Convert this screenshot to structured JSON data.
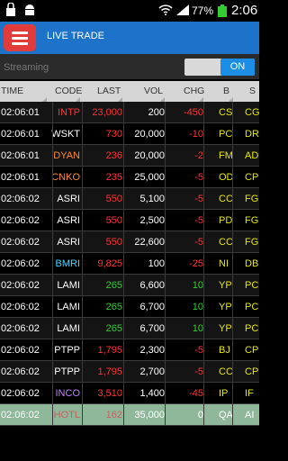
{
  "status_bar": {
    "percent": "77%",
    "time": "2:06"
  },
  "app_bar": {
    "title": "LIVE TRADE"
  },
  "streaming": {
    "label": "Streaming",
    "toggle": "ON"
  },
  "columns": [
    "TIME",
    "CODE",
    "LAST",
    "VOL",
    "CHG",
    "B",
    "S"
  ],
  "rows": [
    {
      "time": "02:06:01",
      "code": "INTP",
      "last": "23,000",
      "vol": "200",
      "chg": "-450",
      "b": "CS",
      "s": "CG",
      "code_color": "#ff3333",
      "last_color": "#ff3333",
      "chg_color": "#ff3333"
    },
    {
      "time": "02:06:01",
      "code": "WSKT",
      "last": "730",
      "vol": "20,000",
      "chg": "-10",
      "b": "PC",
      "s": "DR",
      "code_color": "#ffffff",
      "last_color": "#ff3333",
      "chg_color": "#ff3333"
    },
    {
      "time": "02:06:01",
      "code": "DYAN",
      "last": "236",
      "vol": "20,000",
      "chg": "-2",
      "b": "FM",
      "s": "AD",
      "code_color": "#ff8c2a",
      "last_color": "#ff3333",
      "chg_color": "#ff3333"
    },
    {
      "time": "02:06:01",
      "code": "CNKO",
      "last": "235",
      "vol": "25,000",
      "chg": "-5",
      "b": "OD",
      "s": "CP",
      "code_color": "#ff8c2a",
      "last_color": "#ff3333",
      "chg_color": "#ff3333"
    },
    {
      "time": "02:06:02",
      "code": "ASRI",
      "last": "550",
      "vol": "5,100",
      "chg": "-5",
      "b": "CC",
      "s": "FG",
      "code_color": "#ffffff",
      "last_color": "#ff3333",
      "chg_color": "#ff3333"
    },
    {
      "time": "02:06:02",
      "code": "ASRI",
      "last": "550",
      "vol": "2,500",
      "chg": "-5",
      "b": "PD",
      "s": "FG",
      "code_color": "#ffffff",
      "last_color": "#ff3333",
      "chg_color": "#ff3333"
    },
    {
      "time": "02:06:02",
      "code": "ASRI",
      "last": "550",
      "vol": "22,600",
      "chg": "-5",
      "b": "CC",
      "s": "FG",
      "code_color": "#ffffff",
      "last_color": "#ff3333",
      "chg_color": "#ff3333"
    },
    {
      "time": "02:06:02",
      "code": "BMRI",
      "last": "9,825",
      "vol": "100",
      "chg": "-25",
      "b": "NI",
      "s": "DB",
      "code_color": "#44d4ff",
      "last_color": "#ff3333",
      "chg_color": "#ff3333"
    },
    {
      "time": "02:06:02",
      "code": "LAMI",
      "last": "265",
      "vol": "6,600",
      "chg": "10",
      "b": "YP",
      "s": "PC",
      "code_color": "#ffffff",
      "last_color": "#33cc33",
      "chg_color": "#33cc33"
    },
    {
      "time": "02:06:02",
      "code": "LAMI",
      "last": "265",
      "vol": "6,700",
      "chg": "10",
      "b": "YP",
      "s": "PC",
      "code_color": "#ffffff",
      "last_color": "#33cc33",
      "chg_color": "#33cc33"
    },
    {
      "time": "02:06:02",
      "code": "LAMI",
      "last": "265",
      "vol": "6,700",
      "chg": "10",
      "b": "YP",
      "s": "PC",
      "code_color": "#ffffff",
      "last_color": "#33cc33",
      "chg_color": "#33cc33"
    },
    {
      "time": "02:06:02",
      "code": "PTPP",
      "last": "1,795",
      "vol": "2,300",
      "chg": "-5",
      "b": "BJ",
      "s": "CP",
      "code_color": "#ffffff",
      "last_color": "#ff3333",
      "chg_color": "#ff3333"
    },
    {
      "time": "02:06:02",
      "code": "PTPP",
      "last": "1,795",
      "vol": "2,700",
      "chg": "-5",
      "b": "CC",
      "s": "CP",
      "code_color": "#ffffff",
      "last_color": "#ff3333",
      "chg_color": "#ff3333"
    },
    {
      "time": "02:06:02",
      "code": "INCO",
      "last": "3,510",
      "vol": "1,400",
      "chg": "-45",
      "b": "IP",
      "s": "IF",
      "code_color": "#c080ff",
      "last_color": "#ff3333",
      "chg_color": "#ff3333"
    },
    {
      "time": "02:06:02",
      "code": "HOTL",
      "last": "162",
      "vol": "35,000",
      "chg": "0",
      "b": "QA",
      "s": "AI",
      "code_color": "#ffffff",
      "last_color": "#ffffff",
      "chg_color": "#ffffff",
      "selected": true
    }
  ]
}
